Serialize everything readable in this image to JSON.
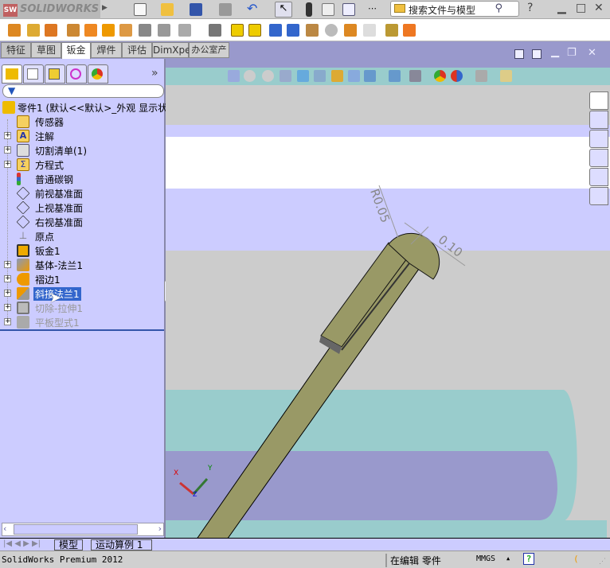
{
  "app": {
    "logo": "SOLIDWORKS"
  },
  "search": {
    "placeholder": "搜索文件与模型"
  },
  "toolbar": {
    "help_label": "?"
  },
  "command_tabs": [
    {
      "label": "特征"
    },
    {
      "label": "草图"
    },
    {
      "label": "钣金",
      "active": true
    },
    {
      "label": "焊件"
    },
    {
      "label": "评估"
    },
    {
      "label": "DimXpert"
    },
    {
      "label": "办公室产品"
    }
  ],
  "panel": {
    "more": "»"
  },
  "tree": {
    "root": "零件1   (默认<<默认>_外观 显示状",
    "items": [
      {
        "label": "传感器",
        "expandable": false
      },
      {
        "label": "注解",
        "expandable": true
      },
      {
        "label": "切割清单(1)",
        "expandable": true
      },
      {
        "label": "方程式",
        "expandable": true
      },
      {
        "label": "普通碳钢",
        "expandable": false
      },
      {
        "label": "前视基准面",
        "expandable": false
      },
      {
        "label": "上视基准面",
        "expandable": false
      },
      {
        "label": "右视基准面",
        "expandable": false
      },
      {
        "label": "原点",
        "expandable": false
      },
      {
        "label": "钣金1",
        "expandable": false
      },
      {
        "label": "基体-法兰1",
        "expandable": true
      },
      {
        "label": "褶边1",
        "expandable": true
      },
      {
        "label": "斜接法兰1",
        "expandable": true,
        "selected": true
      },
      {
        "label": "切除-拉伸1",
        "expandable": true,
        "suppressed": true
      },
      {
        "label": "平板型式1",
        "expandable": true,
        "suppressed": true
      }
    ]
  },
  "viewport": {
    "dim_radius": "R0.05",
    "dim_thickness": "0.10",
    "triad": {
      "x": "X",
      "y": "Y",
      "z": "Z"
    },
    "part_color": "#999966"
  },
  "bottom_tabs": [
    {
      "label": "模型"
    },
    {
      "label": "运动算例 1"
    }
  ],
  "status": {
    "product": "SolidWorks Premium 2012",
    "mode": "在编辑 零件",
    "units": "MMGS",
    "units_arrow": "▲",
    "help": "?"
  }
}
